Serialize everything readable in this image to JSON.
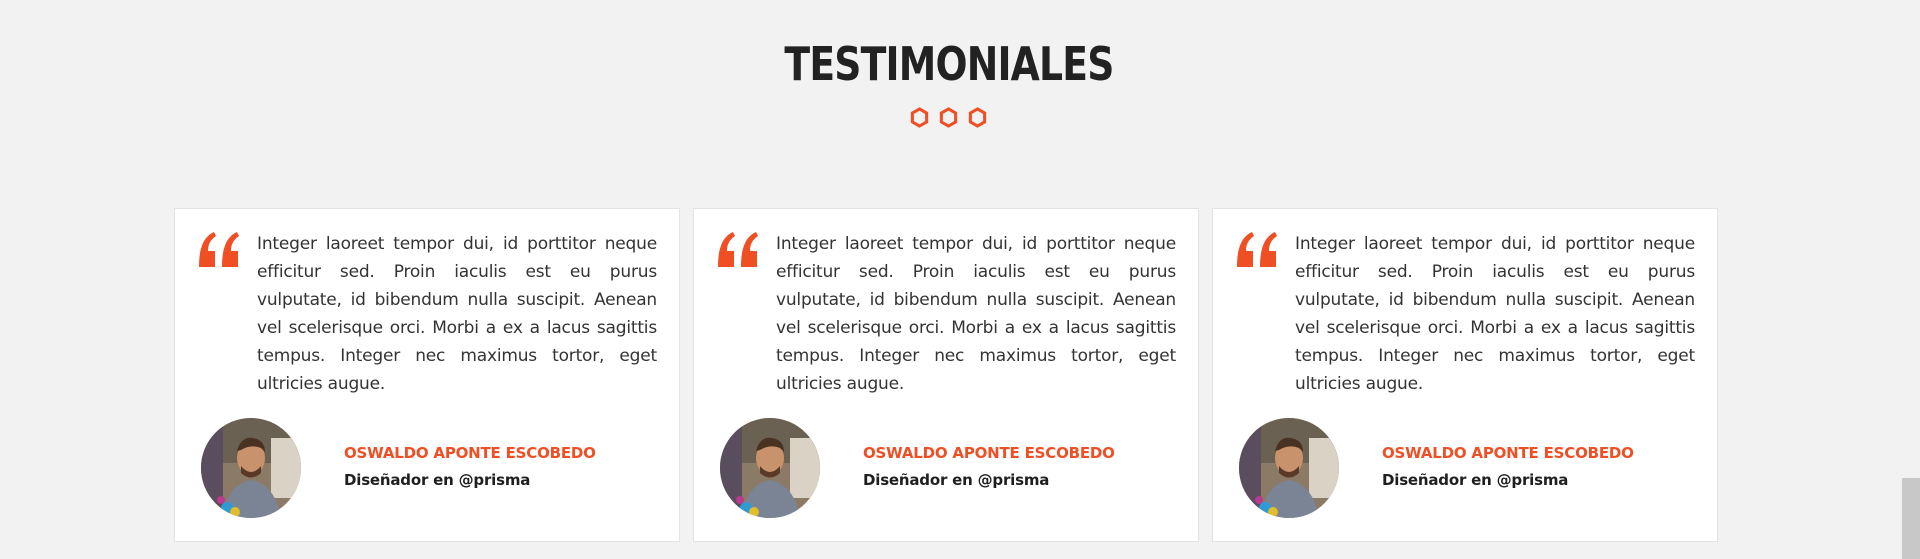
{
  "section": {
    "title": "TESTIMONIALES",
    "accent_color": "#f04e23",
    "divider_icons": [
      "hexagon-icon",
      "hexagon-icon",
      "hexagon-icon"
    ]
  },
  "testimonials": [
    {
      "quote_icon": "quote-icon",
      "text": "Integer laoreet tempor dui, id porttitor neque efficitur sed. Proin iaculis est eu purus vulputate, id bibendum nulla suscipit. Aenean vel scelerisque orci. Morbi a ex a lacus sagittis tempus. Integer nec maximus tortor, eget ultricies augue.",
      "author_name": "OSWALDO APONTE ESCOBEDO",
      "author_role": "Diseñador en @prisma"
    },
    {
      "quote_icon": "quote-icon",
      "text": "Integer laoreet tempor dui, id porttitor neque efficitur sed. Proin iaculis est eu purus vulputate, id bibendum nulla suscipit. Aenean vel scelerisque orci. Morbi a ex a lacus sagittis tempus. Integer nec maximus tortor, eget ultricies augue.",
      "author_name": "OSWALDO APONTE ESCOBEDO",
      "author_role": "Diseñador en @prisma"
    },
    {
      "quote_icon": "quote-icon",
      "text": "Integer laoreet tempor dui, id porttitor neque efficitur sed. Proin iaculis est eu purus vulputate, id bibendum nulla suscipit. Aenean vel scelerisque orci. Morbi a ex a lacus sagittis tempus. Integer nec maximus tortor, eget ultricies augue.",
      "author_name": "OSWALDO APONTE ESCOBEDO",
      "author_role": "Diseñador en @prisma"
    }
  ]
}
